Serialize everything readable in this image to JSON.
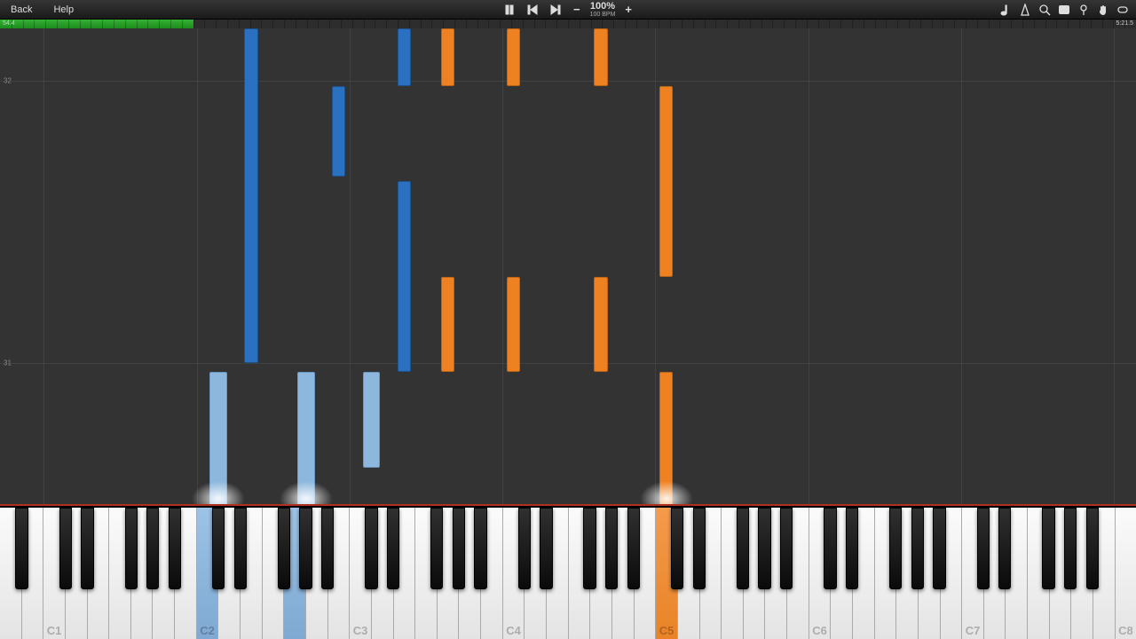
{
  "menu": {
    "back": "Back",
    "help": "Help"
  },
  "transport": {
    "speed_percent": "100%",
    "speed_bpm": "100 BPM",
    "minus": "−",
    "plus": "+"
  },
  "progress": {
    "current_time": "54.4",
    "total_time": "5:21.5",
    "fill_percent": 17
  },
  "measures": [
    {
      "n": "32",
      "y_pct": 11
    },
    {
      "n": "31",
      "y_pct": 70
    }
  ],
  "octave_labels": [
    "C1",
    "C2",
    "C3",
    "C4",
    "C5",
    "C6",
    "C7",
    "C8"
  ],
  "keys": {
    "white_count": 52,
    "first_midi_white": 21,
    "pressed_white": [
      {
        "index": 9,
        "cls": "pressed-blue"
      },
      {
        "index": 13,
        "cls": "pressed-blue"
      },
      {
        "index": 30,
        "cls": "pressed-orange"
      }
    ],
    "pressed_black": []
  },
  "notes": [
    {
      "white_index": 11,
      "top_pct": 0,
      "h_pct": 70,
      "w": 1.0,
      "cls": "blue-dark"
    },
    {
      "white_index": 15,
      "top_pct": 12,
      "h_pct": 19,
      "w": 1.0,
      "cls": "blue-dark"
    },
    {
      "white_index": 18,
      "top_pct": 0,
      "h_pct": 12,
      "w": 1.0,
      "cls": "blue-dark"
    },
    {
      "white_index": 18,
      "top_pct": 32,
      "h_pct": 40,
      "w": 1.0,
      "cls": "blue-dark"
    },
    {
      "white_index": 20,
      "top_pct": 0,
      "h_pct": 12,
      "w": 1.0,
      "cls": "orange"
    },
    {
      "white_index": 20,
      "top_pct": 52,
      "h_pct": 20,
      "w": 1.0,
      "cls": "orange"
    },
    {
      "white_index": 23,
      "top_pct": 0,
      "h_pct": 12,
      "w": 1.0,
      "cls": "orange"
    },
    {
      "white_index": 23,
      "top_pct": 52,
      "h_pct": 20,
      "w": 1.0,
      "cls": "orange"
    },
    {
      "white_index": 27,
      "top_pct": 0,
      "h_pct": 12,
      "w": 1.0,
      "cls": "orange"
    },
    {
      "white_index": 27,
      "top_pct": 52,
      "h_pct": 20,
      "w": 1.0,
      "cls": "orange"
    },
    {
      "white_index": 30,
      "top_pct": 12,
      "h_pct": 40,
      "w": 1.0,
      "cls": "orange"
    },
    {
      "white_index": 30,
      "top_pct": 72,
      "h_pct": 28,
      "w": 1.0,
      "cls": "orange"
    },
    {
      "white_index": 9.5,
      "top_pct": 72,
      "h_pct": 28,
      "w": 1.3,
      "cls": "blue-light"
    },
    {
      "white_index": 13.5,
      "top_pct": 72,
      "h_pct": 28,
      "w": 1.3,
      "cls": "blue-light"
    },
    {
      "white_index": 16.5,
      "top_pct": 72,
      "h_pct": 20,
      "w": 1.3,
      "cls": "blue-light"
    }
  ],
  "glows": [
    {
      "white_index": 9.5
    },
    {
      "white_index": 13.5
    },
    {
      "white_index": 30
    }
  ],
  "colors": {
    "blue_dark": "#2b71c2",
    "blue_light": "#8db7dd",
    "orange": "#ee8222"
  }
}
